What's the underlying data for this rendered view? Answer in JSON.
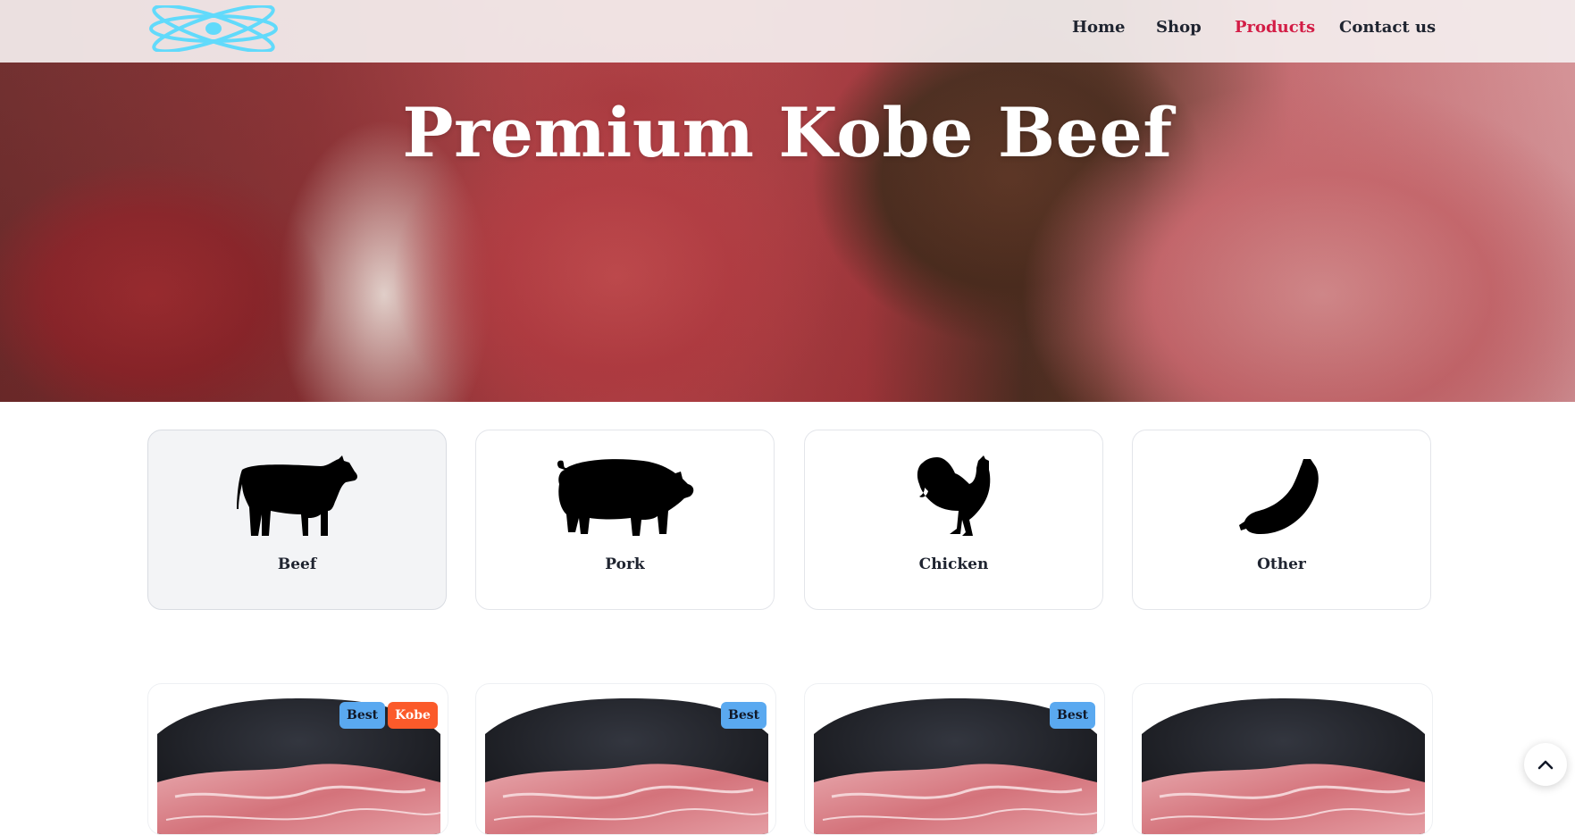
{
  "brand": {
    "logo_icon": "atom-logo-icon",
    "accent_color": "#d31d46",
    "logo_color": "#61dafb"
  },
  "nav": {
    "items": [
      {
        "label": "Home",
        "active": false
      },
      {
        "label": "Shop",
        "active": false
      },
      {
        "label": "Products",
        "active": true
      },
      {
        "label": "Contact us",
        "active": false
      }
    ]
  },
  "hero": {
    "title": "Premium Kobe Beef"
  },
  "categories": [
    {
      "label": "Beef",
      "icon": "cow-icon",
      "selected": true
    },
    {
      "label": "Pork",
      "icon": "pig-icon",
      "selected": false
    },
    {
      "label": "Chicken",
      "icon": "rooster-icon",
      "selected": false
    },
    {
      "label": "Other",
      "icon": "sausage-icon",
      "selected": false
    }
  ],
  "products": [
    {
      "badges": [
        "Best",
        "Kobe"
      ]
    },
    {
      "badges": [
        "Best"
      ]
    },
    {
      "badges": [
        "Best"
      ]
    },
    {
      "badges": []
    }
  ],
  "back_to_top": {
    "icon": "chevron-up-icon"
  }
}
